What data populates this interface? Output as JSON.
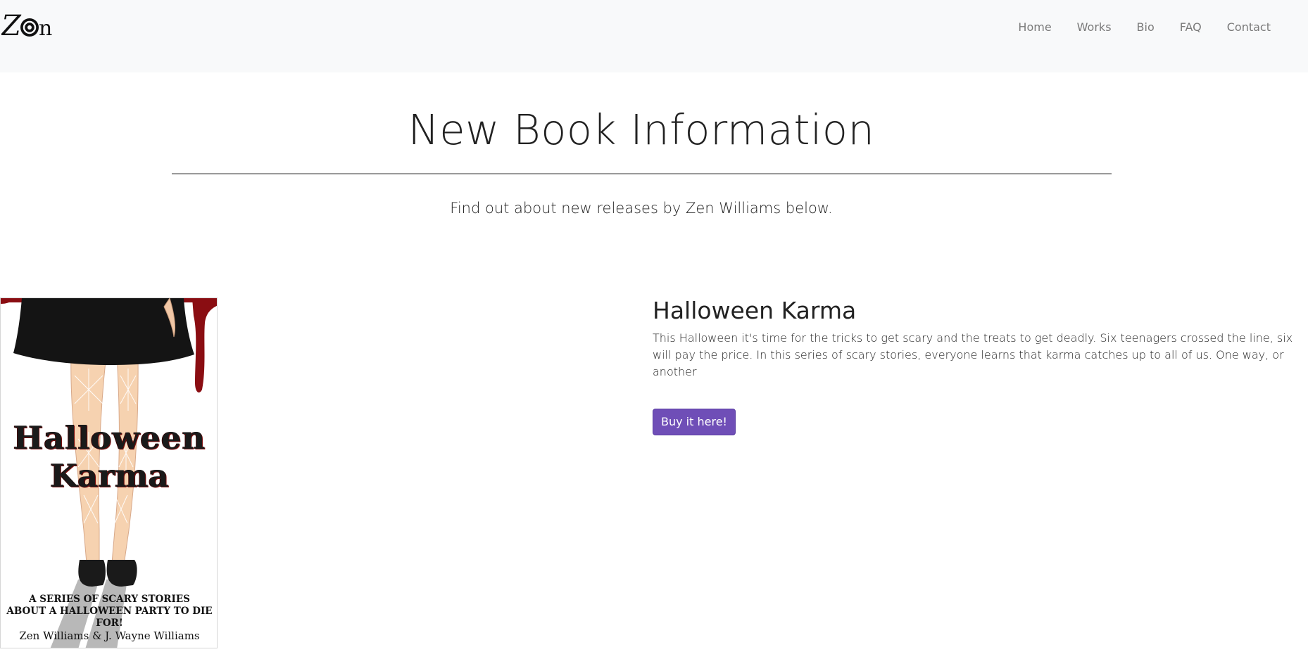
{
  "navbar": {
    "logo_text": "Zen",
    "links": [
      {
        "label": "Home"
      },
      {
        "label": "Works"
      },
      {
        "label": "Bio"
      },
      {
        "label": "FAQ"
      },
      {
        "label": "Contact"
      }
    ]
  },
  "header": {
    "title": "New Book Information",
    "subtitle": "Find out about new releases by Zen Williams below."
  },
  "book": {
    "cover": {
      "title_line1": "Halloween",
      "title_line2": "Karma",
      "tagline_line1": "A SERIES OF SCARY STORIES",
      "tagline_line2": "ABOUT A HALLOWEEN PARTY TO DIE FOR!",
      "authors": "Zen Williams & J. Wayne Williams"
    },
    "title": "Halloween Karma",
    "description": "This Halloween it's time for the tricks to get scary and the treats to get deadly. Six teenagers crossed the line, six will pay the price. In this series of scary stories, everyone learns that karma catches up to all of us. One way, or another",
    "buy_label": "Buy it here!"
  },
  "colors": {
    "navbar_bg": "#f8f9fa",
    "button_bg": "#6f4eb7",
    "rule": "#9a9a9a"
  }
}
